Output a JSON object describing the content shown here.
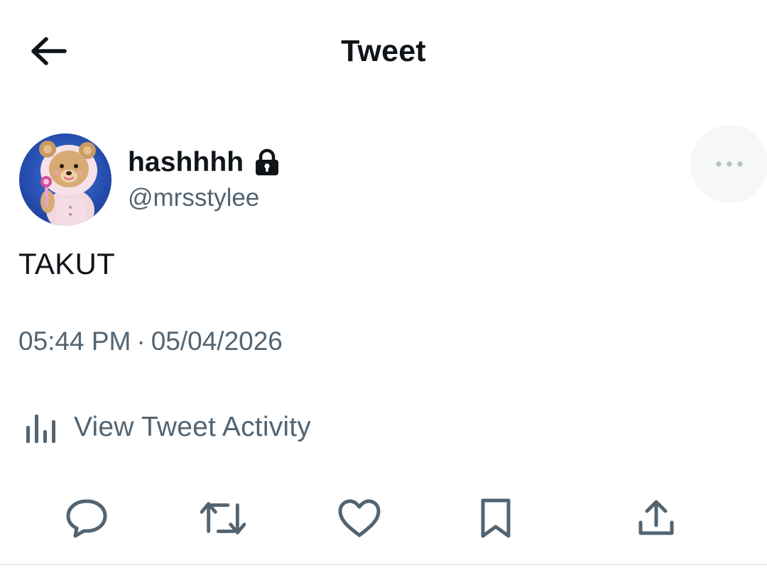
{
  "header": {
    "title": "Tweet",
    "back_icon": "arrow-left-icon"
  },
  "author": {
    "display_name": "hashhhh",
    "handle": "@mrsstylee",
    "protected_icon": "lock-icon",
    "avatar_description": "teddy-bear-avatar"
  },
  "more_icon": "more-horizontal-icon",
  "tweet": {
    "text": "TAKUT",
    "time": "05:44 PM",
    "separator": "·",
    "date": "05/04/2026"
  },
  "activity": {
    "label": "View Tweet Activity",
    "icon": "analytics-bars-icon"
  },
  "actions": [
    {
      "name": "reply",
      "icon": "reply-icon"
    },
    {
      "name": "retweet",
      "icon": "retweet-icon"
    },
    {
      "name": "like",
      "icon": "heart-icon"
    },
    {
      "name": "bookmark",
      "icon": "bookmark-icon"
    },
    {
      "name": "share",
      "icon": "share-icon"
    }
  ],
  "colors": {
    "text_primary": "#0f1419",
    "text_secondary": "#536471",
    "more_button_bg": "#f6f7f7",
    "icon_gray": "#536471"
  }
}
